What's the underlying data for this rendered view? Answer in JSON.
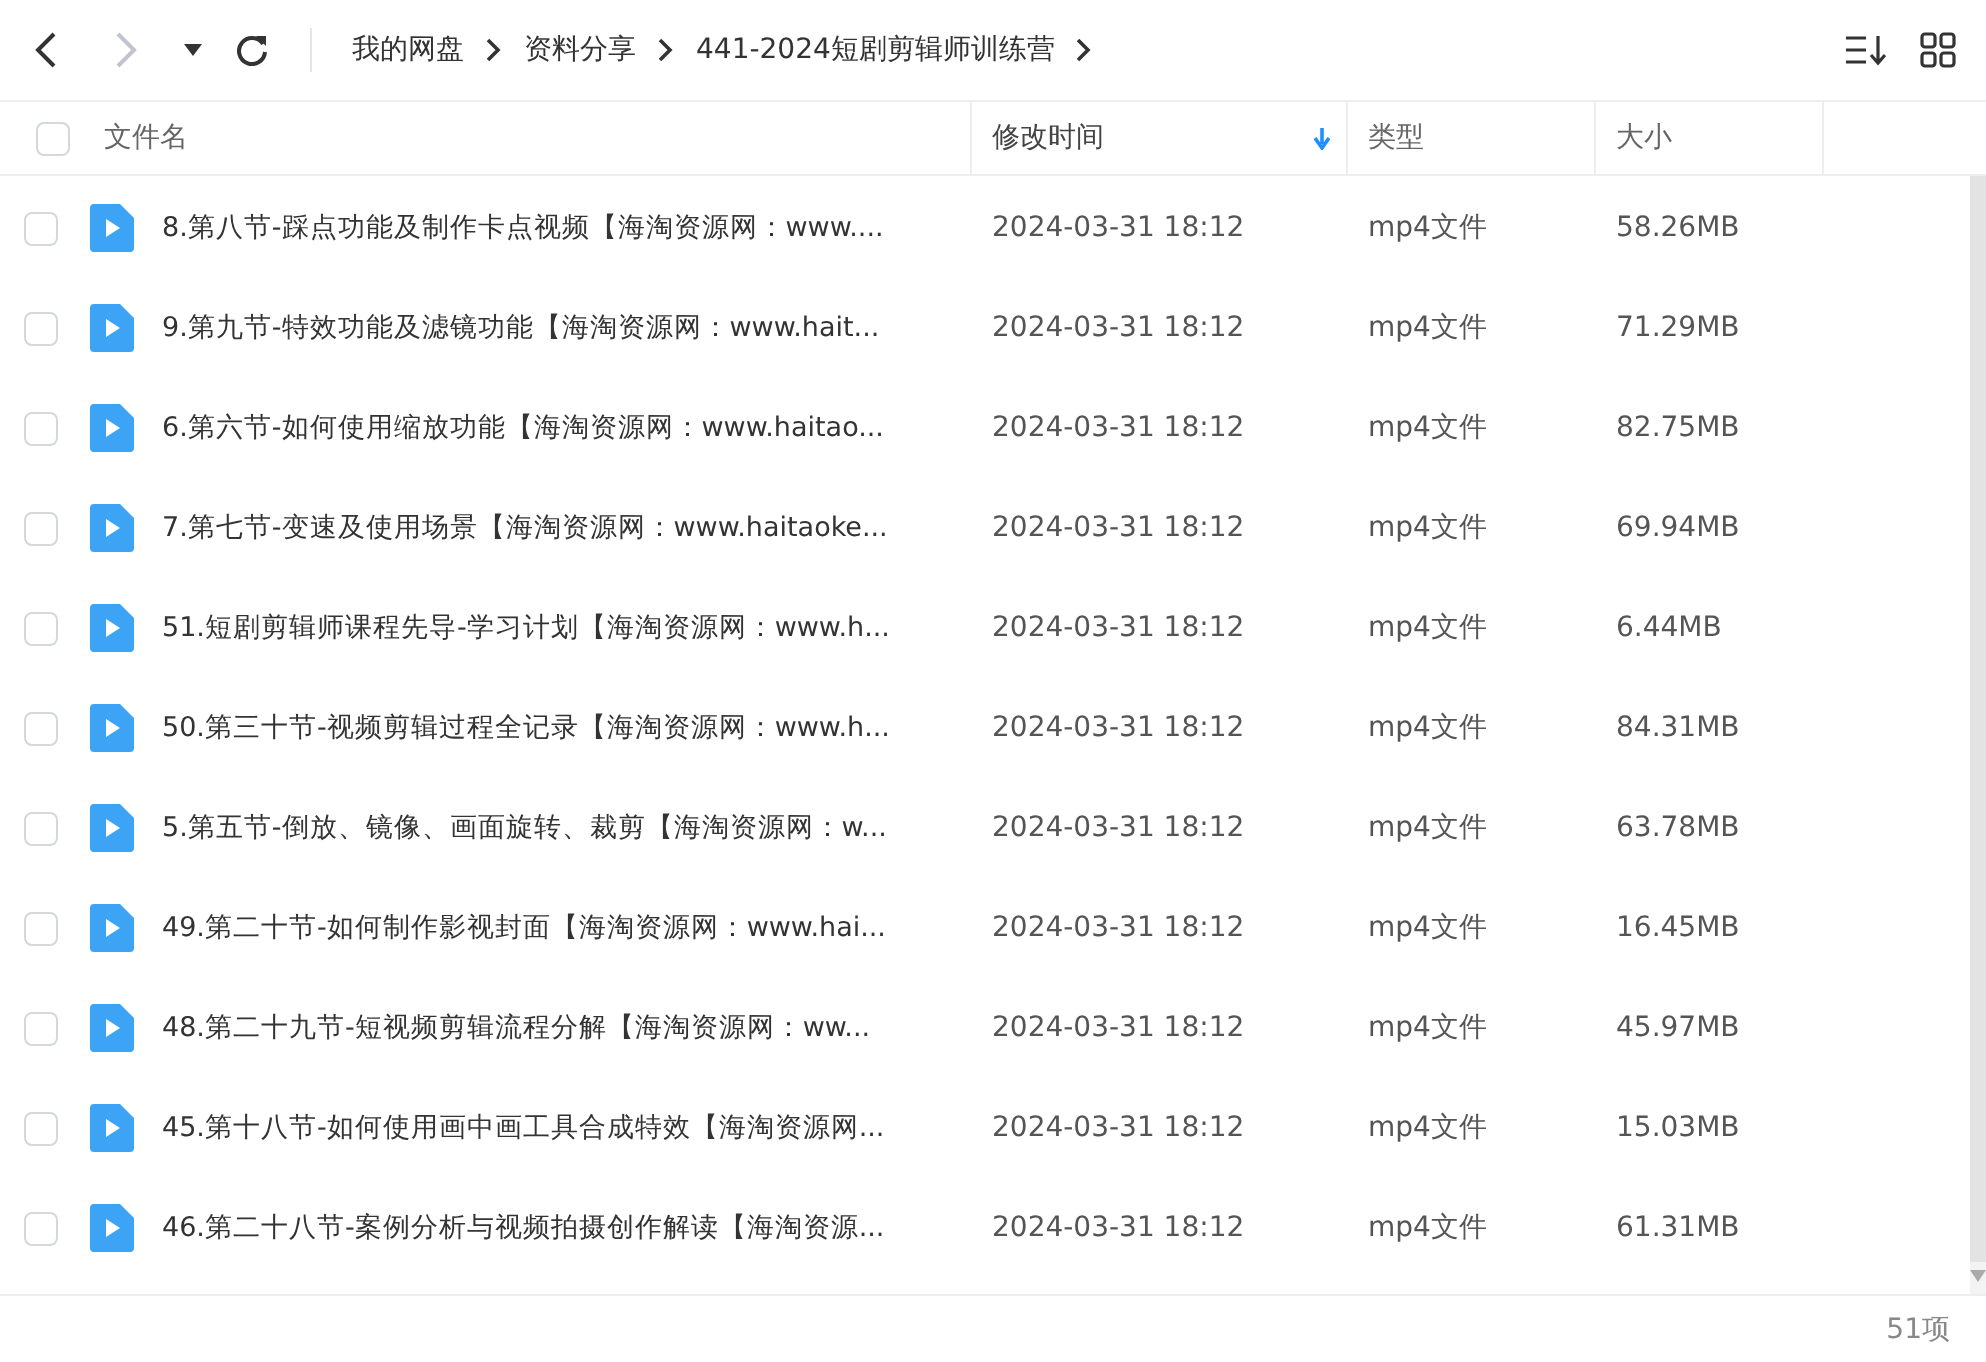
{
  "toolbar": {
    "back_disabled": false,
    "forward_disabled": true,
    "breadcrumb": [
      "我的网盘",
      "资料分享",
      "441-2024短剧剪辑师训练营"
    ]
  },
  "table": {
    "all_checked": false,
    "columns": [
      {
        "label": "文件名",
        "sorted": false
      },
      {
        "label": "修改时间",
        "sorted": true
      },
      {
        "label": "类型",
        "sorted": false
      },
      {
        "label": "大小",
        "sorted": false
      }
    ],
    "rows": [
      {
        "checked": false,
        "name": "8.第八节-踩点功能及制作卡点视频【海淘资源网：www....",
        "modified": "2024-03-31 18:12",
        "type": "mp4文件",
        "size": "58.26MB"
      },
      {
        "checked": false,
        "name": "9.第九节-特效功能及滤镜功能【海淘资源网：www.hait...",
        "modified": "2024-03-31 18:12",
        "type": "mp4文件",
        "size": "71.29MB"
      },
      {
        "checked": false,
        "name": "6.第六节-如何使用缩放功能【海淘资源网：www.haitao...",
        "modified": "2024-03-31 18:12",
        "type": "mp4文件",
        "size": "82.75MB"
      },
      {
        "checked": false,
        "name": "7.第七节-变速及使用场景【海淘资源网：www.haitaoke...",
        "modified": "2024-03-31 18:12",
        "type": "mp4文件",
        "size": "69.94MB"
      },
      {
        "checked": false,
        "name": "51.短剧剪辑师课程先导-学习计划【海淘资源网：www.h...",
        "modified": "2024-03-31 18:12",
        "type": "mp4文件",
        "size": "6.44MB"
      },
      {
        "checked": false,
        "name": "50.第三十节-视频剪辑过程全记录【海淘资源网：www.h...",
        "modified": "2024-03-31 18:12",
        "type": "mp4文件",
        "size": "84.31MB"
      },
      {
        "checked": false,
        "name": "5.第五节-倒放、镜像、画面旋转、裁剪【海淘资源网：w...",
        "modified": "2024-03-31 18:12",
        "type": "mp4文件",
        "size": "63.78MB"
      },
      {
        "checked": false,
        "name": "49.第二十节-如何制作影视封面【海淘资源网：www.hai...",
        "modified": "2024-03-31 18:12",
        "type": "mp4文件",
        "size": "16.45MB"
      },
      {
        "checked": false,
        "name": "48.第二十九节-短视频剪辑流程分解【海淘资源网：ww...",
        "modified": "2024-03-31 18:12",
        "type": "mp4文件",
        "size": "45.97MB"
      },
      {
        "checked": false,
        "name": "45.第十八节-如何使用画中画工具合成特效【海淘资源网...",
        "modified": "2024-03-31 18:12",
        "type": "mp4文件",
        "size": "15.03MB"
      },
      {
        "checked": false,
        "name": "46.第二十八节-案例分析与视频拍摄创作解读【海淘资源...",
        "modified": "2024-03-31 18:12",
        "type": "mp4文件",
        "size": "61.31MB"
      }
    ]
  },
  "status_bar": {
    "count": "51项"
  }
}
